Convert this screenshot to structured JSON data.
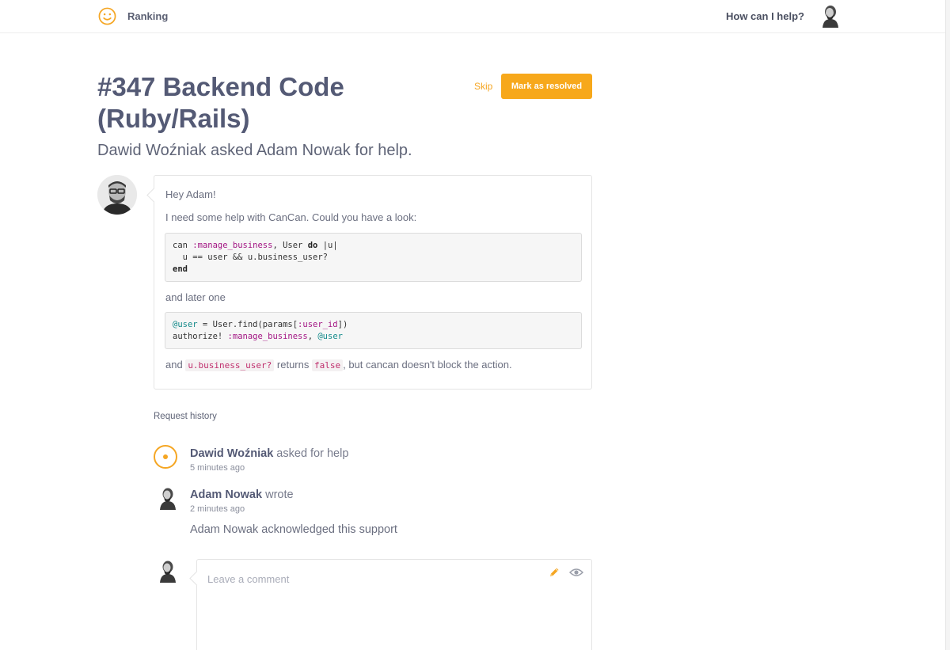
{
  "nav": {
    "logo_icon": "smiley-icon",
    "ranking_label": "Ranking",
    "help_label": "How can I help?",
    "avatar_icon": "user-avatar-icon"
  },
  "request": {
    "title": "#347 Backend Code (Ruby/Rails)",
    "subtitle": "Dawid Woźniak asked Adam Nowak for help.",
    "skip_label": "Skip",
    "resolve_label": "Mark as resolved"
  },
  "message": {
    "greeting": "Hey Adam!",
    "intro": "I need some help with CanCan. Could you have a look:",
    "code1": {
      "line1_a": "can ",
      "line1_sym": ":manage_business",
      "line1_b": ", User ",
      "line1_kw": "do",
      "line1_c": " |u|",
      "line2": "  u == user && u.business_user?",
      "line3_kw": "end"
    },
    "between": "and later one",
    "code2": {
      "line1_ivar": "@user",
      "line1_a": " = User.find(params[",
      "line1_sym": ":user_id",
      "line1_b": "])",
      "line2_a": "authorize! ",
      "line2_sym": ":manage_business",
      "line2_b": ", ",
      "line2_ivar": "@user"
    },
    "outro": {
      "prefix": "and ",
      "code_a": "u.business_user?",
      "mid": " returns ",
      "code_b": "false",
      "suffix": ", but cancan doesn't block the action."
    }
  },
  "history": {
    "title": "Request history",
    "events": [
      {
        "name": "Dawid Woźniak",
        "action": " asked for help",
        "time": "5 minutes ago",
        "icon": "target-icon"
      },
      {
        "name": "Adam Nowak",
        "action": " wrote",
        "time": "2 minutes ago",
        "body": "Adam Nowak acknowledged this support",
        "icon": "user-avatar-icon"
      }
    ]
  },
  "comment": {
    "placeholder": "Leave a comment",
    "edit_icon": "pencil-icon",
    "preview_icon": "eye-icon"
  },
  "colors": {
    "accent": "#f7a81b",
    "title": "#545a75",
    "text": "#6b6f80"
  }
}
